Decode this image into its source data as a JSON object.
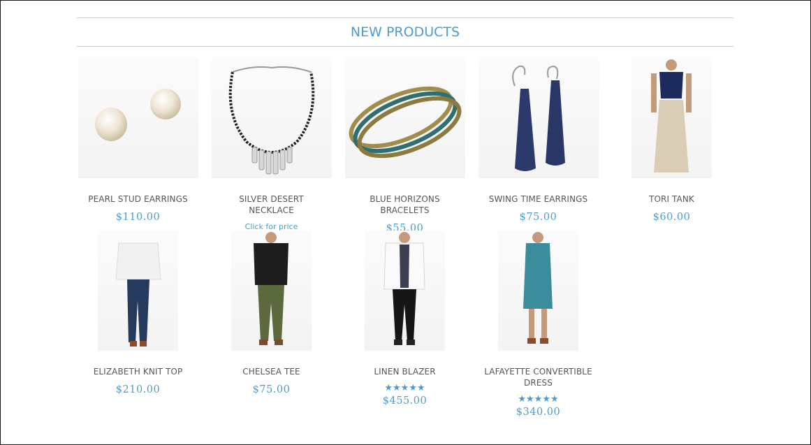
{
  "section": {
    "title": "NEW PRODUCTS"
  },
  "colors": {
    "accent": "#4c9ccd",
    "text": "#555555",
    "rule": "#c9c9c9"
  },
  "products": [
    {
      "name": "PEARL STUD EARRINGS",
      "price": "$110.00",
      "image": "pearl-earrings"
    },
    {
      "name": "SILVER DESERT NECKLACE",
      "price_link": "Click for price",
      "image": "silver-necklace"
    },
    {
      "name": "BLUE HORIZONS BRACELETS",
      "price": "$55.00",
      "image": "bangles"
    },
    {
      "name": "SWING TIME EARRINGS",
      "price": "$75.00",
      "image": "navy-drop-earrings"
    },
    {
      "name": "TORI TANK",
      "price": "$60.00",
      "image": "model-tank"
    },
    {
      "name": "ELIZABETH KNIT TOP",
      "price": "$210.00",
      "image": "model-knit-top"
    },
    {
      "name": "CHELSEA TEE",
      "price": "$75.00",
      "image": "model-tee"
    },
    {
      "name": "LINEN BLAZER",
      "price": "$455.00",
      "rating": "★★★★★",
      "rating_value": 5,
      "image": "model-blazer"
    },
    {
      "name": "LAFAYETTE CONVERTIBLE DRESS",
      "price": "$340.00",
      "rating": "★★★★★",
      "rating_value": 5,
      "image": "model-dress"
    }
  ]
}
